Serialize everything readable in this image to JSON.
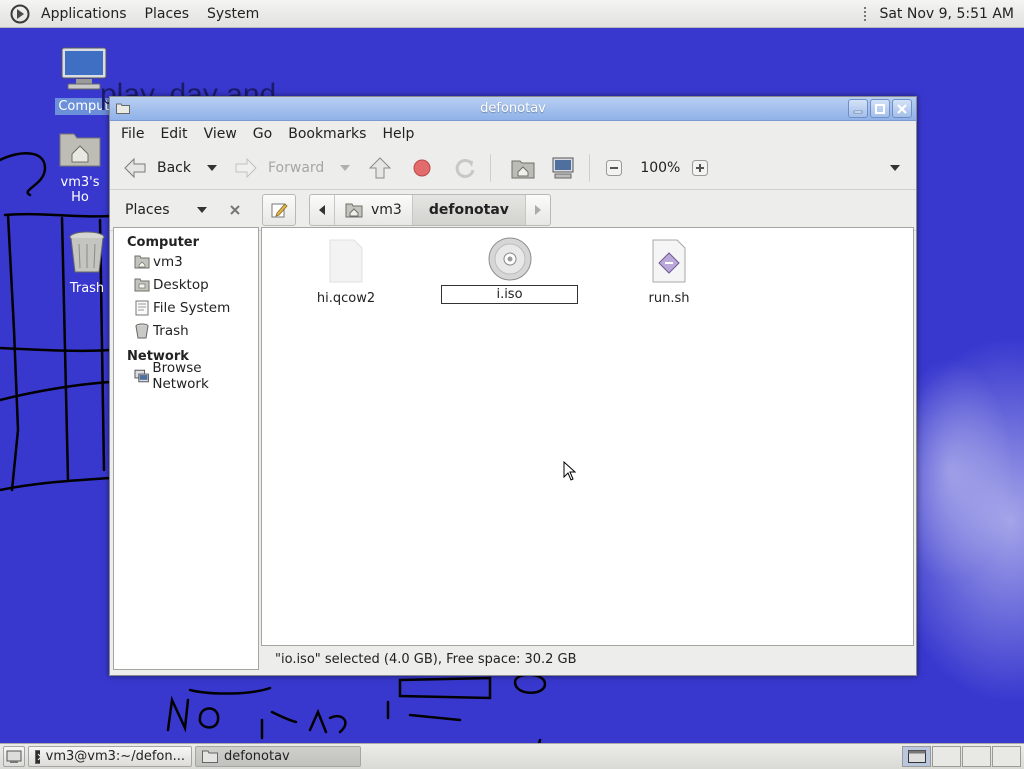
{
  "top_panel": {
    "menus": [
      "Applications",
      "Places",
      "System"
    ],
    "clock": "Sat Nov 9,  5:51 AM"
  },
  "desktop": {
    "icons": [
      {
        "label": "Comput"
      },
      {
        "label": "vm3's Ho"
      },
      {
        "label": "Trash"
      }
    ],
    "overlay_text": "play, day and"
  },
  "window": {
    "title": "defonotav",
    "menubar": [
      "File",
      "Edit",
      "View",
      "Go",
      "Bookmarks",
      "Help"
    ],
    "toolbar": {
      "back_label": "Back",
      "forward_label": "Forward",
      "zoom_level": "100%"
    },
    "places_label": "Places",
    "breadcrumb": [
      "vm3",
      "defonotav"
    ],
    "sidebar": {
      "computer_header": "Computer",
      "computer_items": [
        "vm3",
        "Desktop",
        "File System",
        "Trash"
      ],
      "network_header": "Network",
      "network_items": [
        "Browse Network"
      ]
    },
    "files": [
      {
        "name": "hi.qcow2",
        "icon": "blank-file-icon"
      },
      {
        "name": "io.iso",
        "icon": "disc-image-icon",
        "rename_value": "i.iso",
        "selected": true
      },
      {
        "name": "run.sh",
        "icon": "script-icon"
      }
    ],
    "status": "\"io.iso\" selected (4.0 GB), Free space: 30.2 GB"
  },
  "taskbar": {
    "tasks": [
      "vm3@vm3:~/defon...",
      "defonotav"
    ]
  },
  "colors": {
    "desktop": "#3838cf",
    "titlebar": "#8fb2e8",
    "selection": "#6b8fd9"
  }
}
